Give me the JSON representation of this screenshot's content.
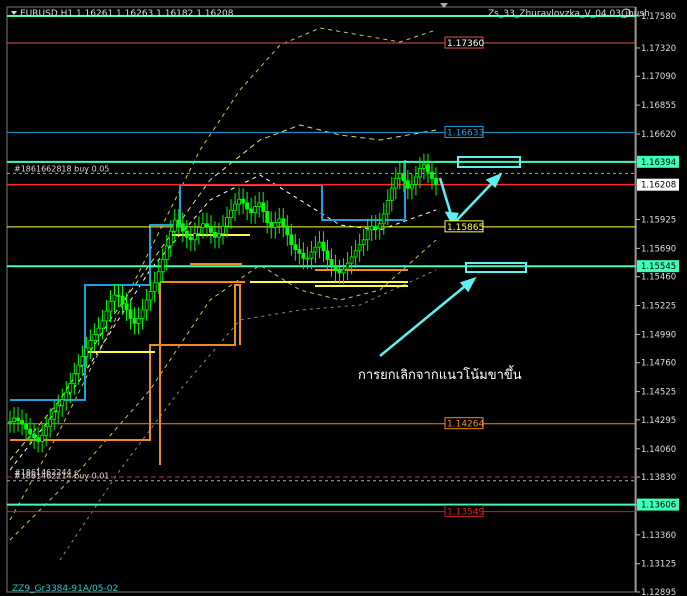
{
  "window": {
    "symbol_header": "EURUSD,H1  1.16261 1.16263 1.16182 1.16208",
    "indicator_name": "Zs_33_Zhuravlovzka_V_04.03_ibush",
    "footer_text": "ZZ9_Gr3384-91A/05-02"
  },
  "annotation": {
    "text": "การยกเลิกจากแนวโน้มขาขึ้น"
  },
  "colors": {
    "background": "#000000",
    "candle": "#00ff00",
    "support_resistance": "#3dffb6",
    "blue_step": "#1fa0e0",
    "orange_step": "#f08c1e",
    "yellow": "#ffff40",
    "red_line": "#ff2a2a",
    "arrow": "#5ff0f0"
  },
  "chart_data": {
    "type": "line",
    "y_axis": {
      "ticks": [
        "1.17580",
        "1.17320",
        "1.17090",
        "1.16855",
        "1.16620",
        "1.16394",
        "1.16208",
        "1.15925",
        "1.15690",
        "1.15460",
        "1.15225",
        "1.14990",
        "1.14760",
        "1.14525",
        "1.14295",
        "1.14060",
        "1.13830",
        "1.13606",
        "1.13360",
        "1.13125",
        "1.12895"
      ]
    },
    "series": [
      {
        "values": [
          1.1428,
          1.1431,
          1.1429,
          1.1426,
          1.1422,
          1.1418,
          1.1415,
          1.1412,
          1.1417,
          1.1424,
          1.143,
          1.1436,
          1.1441,
          1.1446,
          1.1452,
          1.1459,
          1.1467,
          1.1474,
          1.1481,
          1.1488,
          1.1494,
          1.1499,
          1.1504,
          1.151,
          1.1518,
          1.1526,
          1.1531,
          1.153,
          1.1524,
          1.1519,
          1.1512,
          1.1508,
          1.1512,
          1.1519,
          1.1527,
          1.1534,
          1.1541,
          1.155,
          1.156,
          1.1571,
          1.1583,
          1.1592,
          1.1589,
          1.1583,
          1.1578,
          1.1576,
          1.1581,
          1.1586,
          1.1589,
          1.1587,
          1.1582,
          1.1578,
          1.1581,
          1.1587,
          1.1594,
          1.16,
          1.1605,
          1.1609,
          1.1606,
          1.1601,
          1.1598,
          1.1603,
          1.1606,
          1.1599,
          1.159,
          1.1586,
          1.159,
          1.1593,
          1.1587,
          1.158,
          1.1572,
          1.1568,
          1.1565,
          1.1561,
          1.1561,
          1.1566,
          1.157,
          1.1574,
          1.1567,
          1.156,
          1.1555,
          1.1551,
          1.1549,
          1.1552,
          1.1557,
          1.1562,
          1.1567,
          1.1572,
          1.1576,
          1.1584,
          1.1587,
          1.1585,
          1.1589,
          1.1597,
          1.1608,
          1.1618,
          1.1626,
          1.163,
          1.1624,
          1.1618,
          1.1621,
          1.1627,
          1.1634,
          1.1637,
          1.1631,
          1.1626,
          1.1621
        ]
      }
    ],
    "horizontal_lines": [
      {
        "price": 1.1758,
        "label": "1.17580"
      },
      {
        "price": 1.1736,
        "label": "1.17360"
      },
      {
        "price": 1.16633,
        "label": "1.16633"
      },
      {
        "price": 1.16394,
        "label": "1.16394"
      },
      {
        "price": 1.163,
        "label": "#1861662818 buy 0.05"
      },
      {
        "price": 1.16208,
        "label": "1.16208"
      },
      {
        "price": 1.15865,
        "label": "1.15865"
      },
      {
        "price": 1.15545,
        "label": "1.15545"
      },
      {
        "price": 1.14264,
        "label": "1.14264"
      },
      {
        "price": 1.1383,
        "label": "#1861462244 s"
      },
      {
        "price": 1.138,
        "label": "#1861462214 buy 0.01"
      },
      {
        "price": 1.13606,
        "label": "1.13606"
      },
      {
        "price": 1.13549,
        "label": "1.13549"
      }
    ]
  }
}
